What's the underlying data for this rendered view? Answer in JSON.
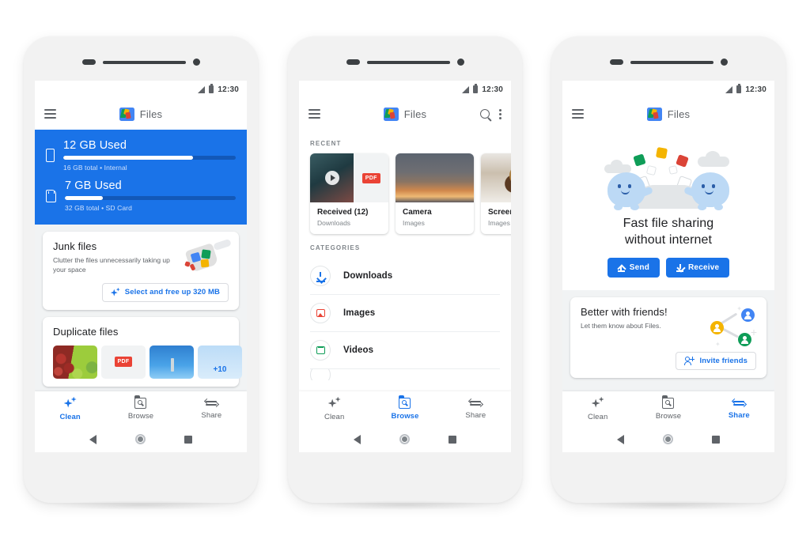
{
  "app": {
    "name": "Files",
    "logo_icon": "files-logo-icon",
    "accent_color": "#1a73e8"
  },
  "status_bar": {
    "time": "12:30",
    "signal_icon": "signal-icon",
    "battery_icon": "battery-icon"
  },
  "bottom_nav": {
    "items": [
      {
        "label": "Clean",
        "icon": "sparkle-icon"
      },
      {
        "label": "Browse",
        "icon": "folder-search-icon"
      },
      {
        "label": "Share",
        "icon": "share-arrows-icon"
      }
    ]
  },
  "system_nav": {
    "back": "back-triangle-icon",
    "home": "home-circle-icon",
    "recents": "recents-square-icon"
  },
  "screens": [
    {
      "id": "clean",
      "active_nav": "Clean",
      "menu_icon": "hamburger-menu-icon",
      "storage": [
        {
          "title": "12 GB Used",
          "subtitle": "16 GB total • Internal",
          "percent": 75,
          "icon": "phone-storage-icon"
        },
        {
          "title": "7 GB Used",
          "subtitle": "32 GB total • SD Card",
          "percent": 22,
          "icon": "sd-card-icon"
        }
      ],
      "junk_card": {
        "title": "Junk files",
        "description": "Clutter the files unnecessarily taking up your space",
        "action_label": "Select and free up 320 MB",
        "action_icon": "sparkle-icon",
        "illustration": "dustpan-with-files-illustration"
      },
      "duplicate_card": {
        "title": "Duplicate files",
        "more_count": "+10",
        "thumbnails": [
          "fruit-photo",
          "pdf-document",
          "sky-photo",
          "more-overlay"
        ]
      }
    },
    {
      "id": "browse",
      "active_nav": "Browse",
      "menu_icon": "hamburger-menu-icon",
      "search_icon": "search-icon",
      "overflow_icon": "more-vertical-icon",
      "recent_label": "RECENT",
      "recent": [
        {
          "name": "Received (12)",
          "location": "Downloads",
          "thumb": "video-and-pdf"
        },
        {
          "name": "Camera",
          "location": "Images",
          "thumb": "sunset-photo"
        },
        {
          "name": "Screen",
          "location": "Images",
          "thumb": "dessert-photo"
        }
      ],
      "categories_label": "CATEGORIES",
      "categories": [
        {
          "label": "Downloads",
          "icon": "download-icon",
          "color": "#1a73e8"
        },
        {
          "label": "Images",
          "icon": "image-icon",
          "color": "#ea4335"
        },
        {
          "label": "Videos",
          "icon": "video-icon",
          "color": "#0f9d58"
        }
      ]
    },
    {
      "id": "share",
      "active_nav": "Share",
      "menu_icon": "hamburger-menu-icon",
      "hero": {
        "title_line1": "Fast file sharing",
        "title_line2": "without internet",
        "illustration": "two-ghosts-sharing-files-illustration",
        "buttons": [
          {
            "label": "Send",
            "icon": "upload-icon"
          },
          {
            "label": "Receive",
            "icon": "download-icon"
          }
        ]
      },
      "friends_card": {
        "title": "Better with friends!",
        "subtitle": "Let them know about Files.",
        "action_label": "Invite friends",
        "action_icon": "person-add-icon",
        "illustration": "connected-people-illustration"
      }
    }
  ]
}
